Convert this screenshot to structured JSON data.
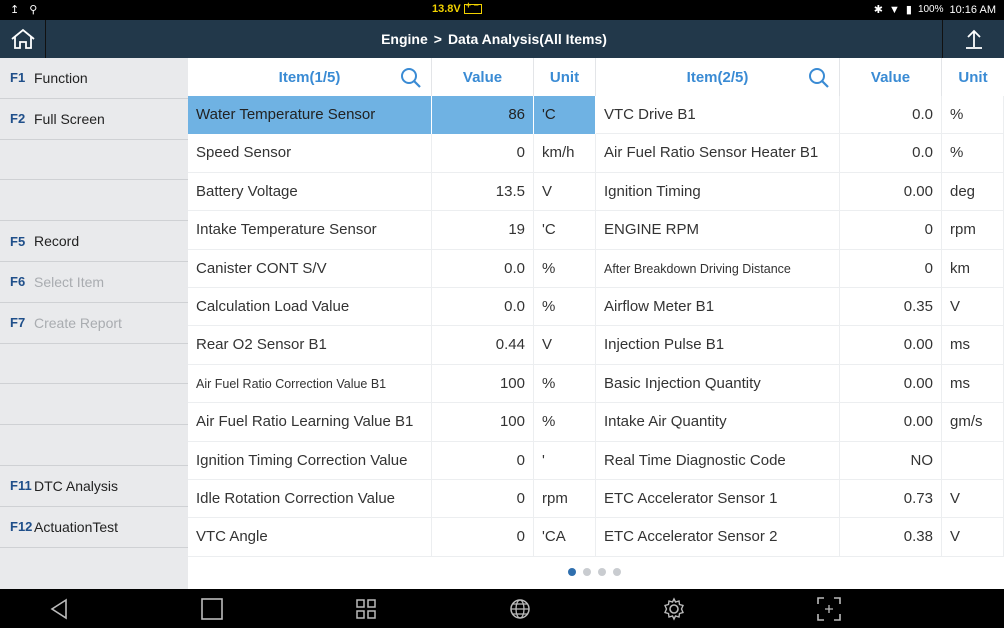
{
  "status": {
    "voltage": "13.8V",
    "battery_pct": "100%",
    "time": "10:16 AM"
  },
  "title": {
    "part1": "Engine",
    "sep": ">",
    "part2": "Data Analysis(All Items)"
  },
  "sidebar": {
    "items": [
      {
        "key": "F1",
        "label": "Function",
        "enabled": true
      },
      {
        "key": "F2",
        "label": "Full Screen",
        "enabled": true
      },
      {
        "key": "",
        "label": "",
        "enabled": true
      },
      {
        "key": "",
        "label": "",
        "enabled": true
      },
      {
        "key": "F5",
        "label": "Record",
        "enabled": true
      },
      {
        "key": "F6",
        "label": "Select Item",
        "enabled": false
      },
      {
        "key": "F7",
        "label": "Create Report",
        "enabled": false
      },
      {
        "key": "",
        "label": "",
        "enabled": true
      },
      {
        "key": "",
        "label": "",
        "enabled": true
      },
      {
        "key": "",
        "label": "",
        "enabled": true
      },
      {
        "key": "F11",
        "label": "DTC Analysis",
        "enabled": true
      },
      {
        "key": "F12",
        "label": "ActuationTest",
        "enabled": true
      }
    ]
  },
  "headers": {
    "left": {
      "item": "Item(1/5)",
      "value": "Value",
      "unit": "Unit"
    },
    "right": {
      "item": "Item(2/5)",
      "value": "Value",
      "unit": "Unit"
    }
  },
  "rows": [
    {
      "l_name": "Water Temperature Sensor",
      "l_val": "86",
      "l_unit": "'C",
      "r_name": "VTC Drive B1",
      "r_val": "0.0",
      "r_unit": "%"
    },
    {
      "l_name": "Speed Sensor",
      "l_val": "0",
      "l_unit": "km/h",
      "r_name": "Air Fuel Ratio Sensor Heater B1",
      "r_val": "0.0",
      "r_unit": "%"
    },
    {
      "l_name": "Battery Voltage",
      "l_val": "13.5",
      "l_unit": "V",
      "r_name": "Ignition Timing",
      "r_val": "0.00",
      "r_unit": "deg"
    },
    {
      "l_name": "Intake Temperature Sensor",
      "l_val": "19",
      "l_unit": "'C",
      "r_name": "ENGINE RPM",
      "r_val": "0",
      "r_unit": "rpm"
    },
    {
      "l_name": "Canister CONT S/V",
      "l_val": "0.0",
      "l_unit": "%",
      "r_name": "After Breakdown Driving Distance",
      "r_val": "0",
      "r_unit": "km"
    },
    {
      "l_name": "Calculation Load Value",
      "l_val": "0.0",
      "l_unit": "%",
      "r_name": "Airflow Meter B1",
      "r_val": "0.35",
      "r_unit": "V"
    },
    {
      "l_name": "Rear O2 Sensor B1",
      "l_val": "0.44",
      "l_unit": "V",
      "r_name": "Injection Pulse B1",
      "r_val": "0.00",
      "r_unit": "ms"
    },
    {
      "l_name": "Air Fuel Ratio Correction Value B1",
      "l_val": "100",
      "l_unit": "%",
      "r_name": "Basic Injection Quantity",
      "r_val": "0.00",
      "r_unit": "ms"
    },
    {
      "l_name": "Air Fuel Ratio Learning Value B1",
      "l_val": "100",
      "l_unit": "%",
      "r_name": "Intake Air Quantity",
      "r_val": "0.00",
      "r_unit": "gm/s"
    },
    {
      "l_name": "Ignition Timing Correction Value",
      "l_val": "0",
      "l_unit": "'",
      "r_name": "Real Time Diagnostic Code",
      "r_val": "NO",
      "r_unit": ""
    },
    {
      "l_name": "Idle Rotation Correction Value",
      "l_val": "0",
      "l_unit": "rpm",
      "r_name": "ETC Accelerator Sensor 1",
      "r_val": "0.73",
      "r_unit": "V"
    },
    {
      "l_name": "VTC Angle",
      "l_val": "0",
      "l_unit": "'CA",
      "r_name": "ETC Accelerator Sensor 2",
      "r_val": "0.38",
      "r_unit": "V"
    }
  ],
  "pager": {
    "count": 4,
    "active": 0
  }
}
